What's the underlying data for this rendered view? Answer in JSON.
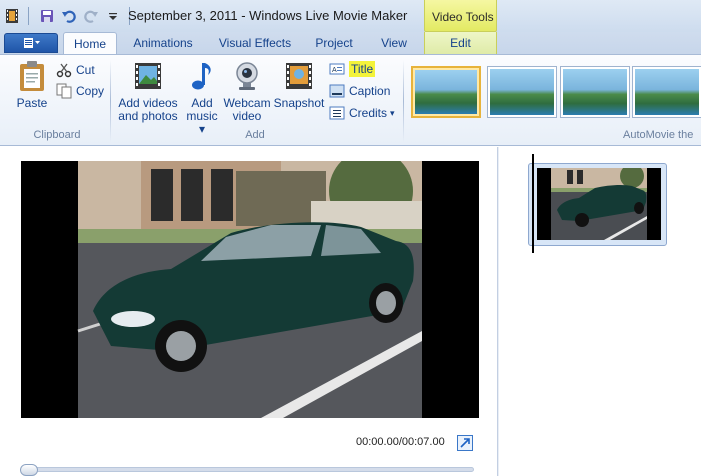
{
  "window": {
    "title": "September 3, 2011 - Windows Live Movie Maker",
    "contextual_group": "Video Tools"
  },
  "quick_access": {
    "app_icon": "film-strip-icon",
    "save_icon": "save-icon",
    "undo_icon": "undo-icon",
    "redo_icon": "redo-icon",
    "customize_icon": "dropdown-arrow-icon"
  },
  "tabs": [
    {
      "label": "Home",
      "active": true
    },
    {
      "label": "Animations",
      "active": false
    },
    {
      "label": "Visual Effects",
      "active": false
    },
    {
      "label": "Project",
      "active": false
    },
    {
      "label": "View",
      "active": false
    },
    {
      "label": "Edit",
      "active": false,
      "contextual": true
    }
  ],
  "ribbon": {
    "clipboard": {
      "label": "Clipboard",
      "paste": "Paste",
      "cut": "Cut",
      "copy": "Copy"
    },
    "add": {
      "label": "Add",
      "add_videos_line1": "Add videos",
      "add_videos_line2": "and photos",
      "add_music_line1": "Add",
      "add_music_line2": "music",
      "webcam_line1": "Webcam",
      "webcam_line2": "video",
      "snapshot": "Snapshot",
      "title": "Title",
      "caption": "Caption",
      "credits": "Credits"
    },
    "automovie": {
      "label": "AutoMovie the",
      "themes_count_visible": 4,
      "selected_theme_index": 0
    }
  },
  "player": {
    "time": "00:00.00/00:07.00",
    "position_fraction": 0.0
  },
  "colors": {
    "accent": "#15428b",
    "title_highlight": "#f3f33a",
    "contextual_tab": "#e3ea63",
    "selected_theme_border": "#e7b33b"
  }
}
